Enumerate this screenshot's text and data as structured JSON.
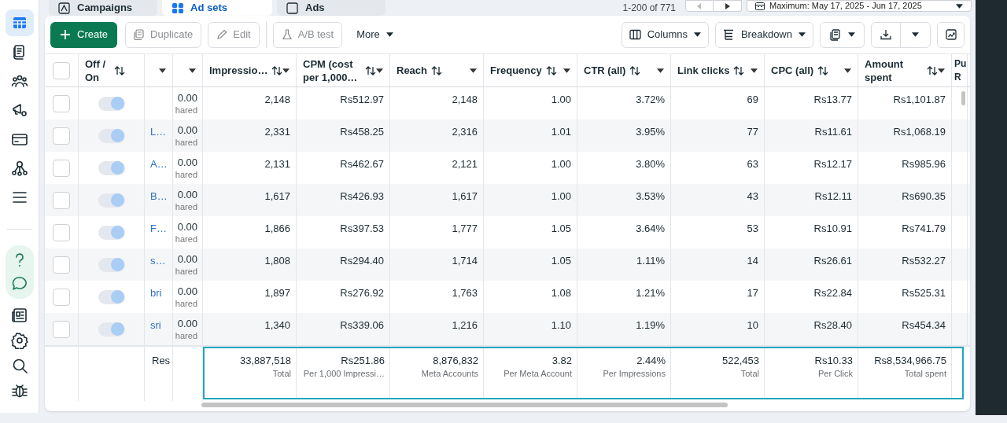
{
  "nav_tabs": [
    {
      "label": "Campaigns",
      "selected": false
    },
    {
      "label": "Ad sets",
      "selected": true
    },
    {
      "label": "Ads",
      "selected": false
    }
  ],
  "pagination": "1-200 of 771",
  "date_range": "Maximum: May 17, 2025 - Jun 17, 2025",
  "sidebar": {
    "items": [
      {
        "kind": "table",
        "selected": true
      },
      {
        "kind": "documents",
        "selected": false
      },
      {
        "kind": "people",
        "selected": false
      },
      {
        "kind": "megaphone",
        "selected": false
      },
      {
        "kind": "card",
        "selected": false
      },
      {
        "kind": "network",
        "selected": false
      },
      {
        "kind": "menu",
        "selected": false
      },
      {
        "kind": "help",
        "selected": false
      },
      {
        "kind": "chat",
        "selected": false
      },
      {
        "kind": "news",
        "selected": false
      },
      {
        "kind": "settings",
        "selected": false
      },
      {
        "kind": "search",
        "selected": false
      },
      {
        "kind": "bug",
        "selected": false
      }
    ]
  },
  "toolbar": {
    "actions": [
      {
        "kind": "create",
        "label": "Create",
        "disabled": false
      },
      {
        "kind": "duplicate",
        "label": "Duplicate",
        "disabled": true
      },
      {
        "kind": "edit",
        "label": "Edit",
        "disabled": true
      },
      {
        "kind": "abtest",
        "label": "A/B test",
        "disabled": true
      },
      {
        "kind": "more",
        "label": "More",
        "disabled": false
      }
    ],
    "view_buttons": [
      {
        "kind": "columns",
        "label": "Columns"
      },
      {
        "kind": "breakdown",
        "label": "Breakdown"
      }
    ]
  },
  "table": {
    "columns": [
      {
        "kind": "select",
        "checked": false
      },
      {
        "kind": "toggle",
        "label": "Off / On"
      },
      {
        "kind": "name"
      },
      {
        "kind": "budget"
      },
      {
        "kind": "metric",
        "label": "Impressio…"
      },
      {
        "kind": "metric",
        "label": "CPM (cost per 1,000…"
      },
      {
        "kind": "metric",
        "label": "Reach"
      },
      {
        "kind": "metric",
        "label": "Frequency"
      },
      {
        "kind": "metric",
        "label": "CTR (all)"
      },
      {
        "kind": "metric",
        "label": "Link clicks"
      },
      {
        "kind": "metric",
        "label": "CPC (all)"
      },
      {
        "kind": "metric",
        "label": "Amount spent"
      },
      {
        "kind": "cut",
        "label": "Pu R"
      }
    ],
    "rows": [
      {
        "checked": false,
        "on": true,
        "budget": "0.00",
        "budget_note": "hared",
        "values": [
          "2,148",
          "Rs512.97",
          "2,148",
          "1.00",
          "3.72%",
          "69",
          "Rs13.77",
          "Rs1,101.87"
        ]
      },
      {
        "checked": false,
        "on": true,
        "name": "L…",
        "budget": "0.00",
        "budget_note": "hared",
        "values": [
          "2,331",
          "Rs458.25",
          "2,316",
          "1.01",
          "3.95%",
          "77",
          "Rs11.61",
          "Rs1,068.19"
        ]
      },
      {
        "checked": false,
        "on": true,
        "name": "A…",
        "budget": "0.00",
        "budget_note": "hared",
        "values": [
          "2,131",
          "Rs462.67",
          "2,121",
          "1.00",
          "3.80%",
          "63",
          "Rs12.17",
          "Rs985.96"
        ]
      },
      {
        "checked": false,
        "on": true,
        "name": "B…",
        "budget": "0.00",
        "budget_note": "hared",
        "values": [
          "1,617",
          "Rs426.93",
          "1,617",
          "1.00",
          "3.53%",
          "43",
          "Rs12.11",
          "Rs690.35"
        ]
      },
      {
        "checked": false,
        "on": true,
        "name": "F…",
        "budget": "0.00",
        "budget_note": "hared",
        "values": [
          "1,866",
          "Rs397.53",
          "1,777",
          "1.05",
          "3.64%",
          "53",
          "Rs10.91",
          "Rs741.79"
        ]
      },
      {
        "checked": false,
        "on": true,
        "name": "s…",
        "budget": "0.00",
        "budget_note": "hared",
        "values": [
          "1,808",
          "Rs294.40",
          "1,714",
          "1.05",
          "1.11%",
          "14",
          "Rs26.61",
          "Rs532.27"
        ]
      },
      {
        "checked": false,
        "on": true,
        "name": "bri",
        "budget": "0.00",
        "budget_note": "hared",
        "values": [
          "1,897",
          "Rs276.92",
          "1,763",
          "1.08",
          "1.21%",
          "17",
          "Rs22.84",
          "Rs525.31"
        ]
      },
      {
        "checked": false,
        "on": true,
        "name": "sri",
        "budget": "0.00",
        "budget_note": "hared",
        "values": [
          "1,340",
          "Rs339.06",
          "1,216",
          "1.10",
          "1.19%",
          "10",
          "Rs28.40",
          "Rs454.34"
        ]
      }
    ],
    "summary": {
      "name": "Res",
      "cells": [
        {
          "value": "33,887,518",
          "caption": "Total"
        },
        {
          "value": "Rs251.86",
          "caption": "Per 1,000 Impressi…"
        },
        {
          "value": "8,876,832",
          "caption": "Meta Accounts"
        },
        {
          "value": "3.82",
          "caption": "Per Meta Account"
        },
        {
          "value": "2.44%",
          "caption": "Per Impressions"
        },
        {
          "value": "522,453",
          "caption": "Total"
        },
        {
          "value": "Rs10.33",
          "caption": "Per Click"
        },
        {
          "value": "Rs8,534,966.75",
          "caption": "Total spent"
        }
      ]
    }
  }
}
